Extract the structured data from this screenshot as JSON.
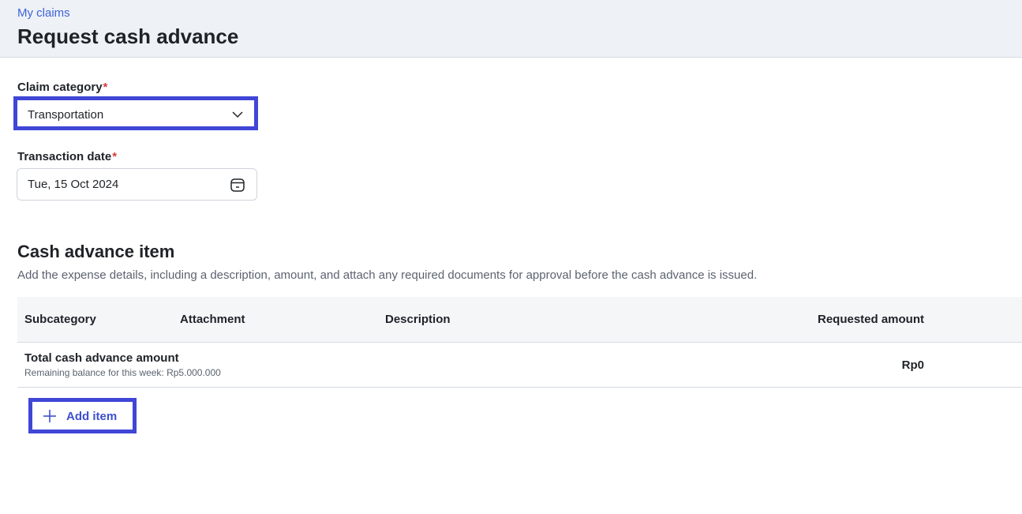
{
  "header": {
    "breadcrumb": "My claims",
    "title": "Request cash advance"
  },
  "form": {
    "claim_category": {
      "label": "Claim category",
      "required_mark": "*",
      "value": "Transportation",
      "icon": "chevron-down-icon"
    },
    "transaction_date": {
      "label": "Transaction date",
      "required_mark": "*",
      "value": "Tue, 15 Oct 2024",
      "icon": "calendar-icon"
    }
  },
  "section": {
    "title": "Cash advance item",
    "description": "Add the expense details, including a description, amount, and attach any required documents for approval before the cash advance is issued."
  },
  "table": {
    "columns": [
      "Subcategory",
      "Attachment",
      "Description",
      "Requested amount"
    ],
    "total": {
      "title": "Total cash advance amount",
      "subtitle": "Remaining balance for this week: Rp5.000.000",
      "amount": "Rp0"
    }
  },
  "actions": {
    "add_item_label": "Add item",
    "add_item_icon": "plus-icon"
  },
  "colors": {
    "accent": "#3d63d8",
    "highlight_border": "#4046d6",
    "required": "#d33b3b",
    "header_bg": "#eef1f6"
  }
}
